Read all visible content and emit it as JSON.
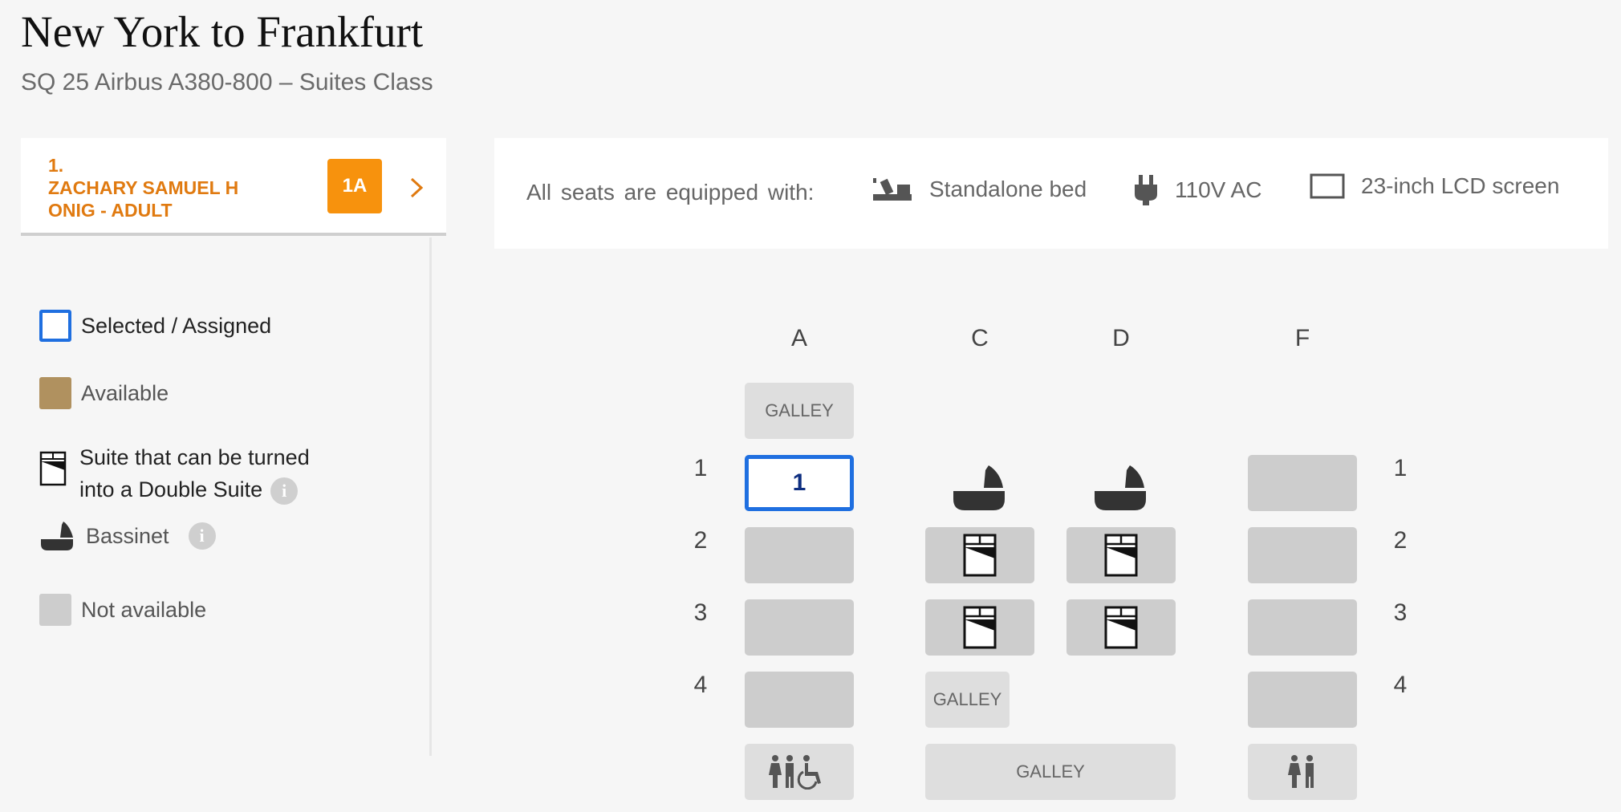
{
  "header": {
    "title": "New York to Frankfurt",
    "subtitle": "SQ 25 Airbus A380-800 – Suites Class"
  },
  "passenger": {
    "number": "1.",
    "name_line1": "ZACHARY SAMUEL H",
    "name_line2": "ONIG - ADULT",
    "seat": "1A"
  },
  "legend": {
    "selected": "Selected / Assigned",
    "available": "Available",
    "double_suite_line1": "Suite that can be turned",
    "double_suite_line2": "into a Double Suite",
    "bassinet": "Bassinet",
    "not_available": "Not available",
    "info_glyph": "i"
  },
  "amenities": {
    "lead": "All seats are equipped with:",
    "bed": "Standalone bed",
    "power": "110V AC",
    "screen": "23-inch LCD screen"
  },
  "seatmap": {
    "columns": [
      "A",
      "C",
      "D",
      "F"
    ],
    "rows": [
      "1",
      "2",
      "3",
      "4"
    ],
    "selected_seat_label": "1",
    "galley_label": "GALLEY"
  },
  "colors": {
    "accent_orange": "#f7920d",
    "name_orange": "#e07a10",
    "selected_blue": "#1f6fe0",
    "available_tan": "#b0915f",
    "unavailable_grey": "#cdcdcd"
  }
}
